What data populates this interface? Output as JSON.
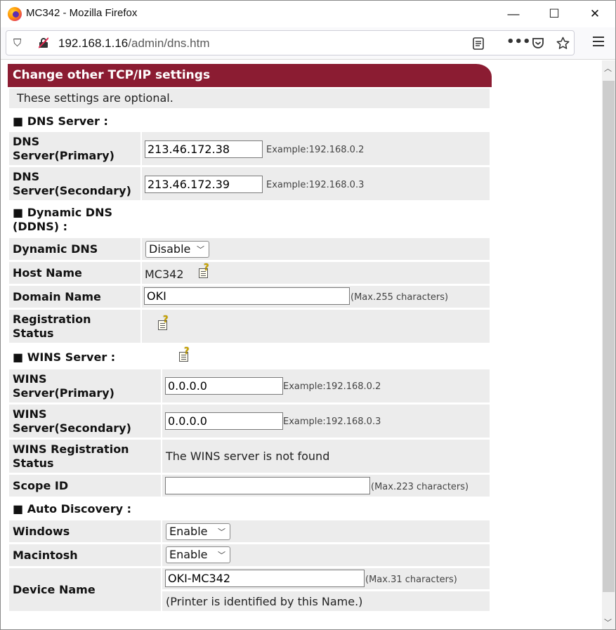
{
  "window": {
    "title": "MC342 - Mozilla Firefox",
    "minimize": "—",
    "maximize": "☐",
    "close": "✕"
  },
  "navbar": {
    "url_host": "192.168.1.16",
    "url_path": "/admin/dns.htm"
  },
  "icons": [
    "firefox-logo",
    "shield-icon",
    "insecure-lock-icon",
    "reader-view-icon",
    "more-icon",
    "pocket-icon",
    "bookmark-star-icon",
    "hamburger-menu-icon",
    "help-icon"
  ],
  "page": {
    "header": "Change other TCP/IP settings",
    "note": "These settings are optional.",
    "sections": {
      "dns": "DNS Server :",
      "ddns_line1": "Dynamic DNS",
      "ddns_line2": "(DDNS) :",
      "wins": "WINS Server :",
      "auto": "Auto Discovery :"
    },
    "dns_primary": {
      "label1": "DNS",
      "label2": "Server(Primary)",
      "value": "213.46.172.38",
      "example": "Example:192.168.0.2"
    },
    "dns_secondary": {
      "label1": "DNS",
      "label2": "Server(Secondary)",
      "value": "213.46.172.39",
      "example": "Example:192.168.0.3"
    },
    "dynamic_dns": {
      "label": "Dynamic DNS",
      "selected": "Disable"
    },
    "host_name": {
      "label": "Host Name",
      "value": "MC342"
    },
    "domain_name": {
      "label": "Domain Name",
      "value": "OKI",
      "hint": "(Max.255 characters)"
    },
    "registration_status": {
      "label1": "Registration",
      "label2": "Status"
    },
    "wins_primary": {
      "label1": "WINS",
      "label2": "Server(Primary)",
      "value": "0.0.0.0",
      "example": "Example:192.168.0.2"
    },
    "wins_secondary": {
      "label1": "WINS",
      "label2": "Server(Secondary)",
      "value": "0.0.0.0",
      "example": "Example:192.168.0.3"
    },
    "wins_registration": {
      "label1": "WINS Registration",
      "label2": "Status",
      "value": "The WINS server is not found"
    },
    "scope_id": {
      "label": "Scope ID",
      "value": "",
      "hint": "(Max.223 characters)"
    },
    "windows": {
      "label": "Windows",
      "selected": "Enable"
    },
    "macintosh": {
      "label": "Macintosh",
      "selected": "Enable"
    },
    "device_name": {
      "label": "Device Name",
      "value": "OKI-MC342",
      "hint": "(Max.31 characters)",
      "note": "(Printer is identified by this Name.)"
    }
  },
  "colors": {
    "header_bg": "#8b1c32",
    "row_bg": "#ececec"
  }
}
